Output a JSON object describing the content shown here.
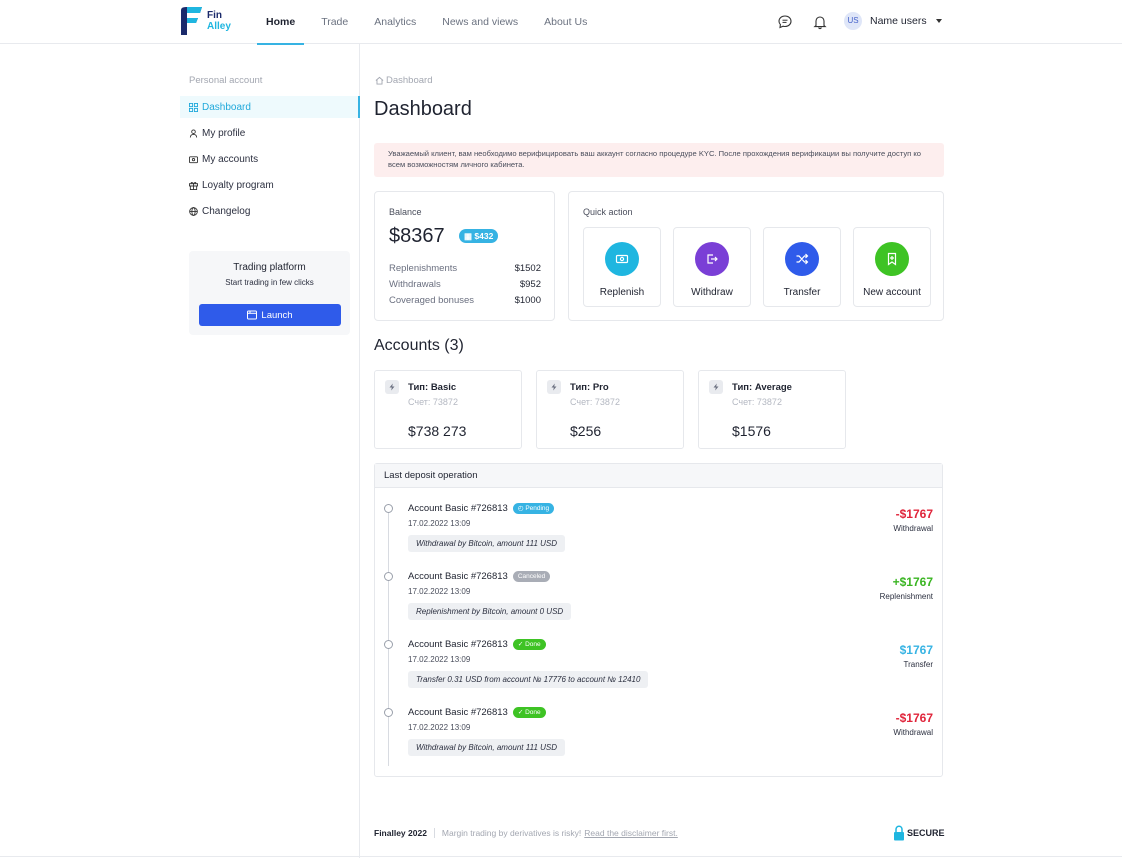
{
  "brand": {
    "line1": "Fin",
    "line2": "Alley"
  },
  "nav": {
    "items": [
      {
        "label": "Home",
        "active": true
      },
      {
        "label": "Trade"
      },
      {
        "label": "Analytics"
      },
      {
        "label": "News and views"
      },
      {
        "label": "About Us"
      }
    ]
  },
  "user": {
    "initials": "US",
    "name": "Name users"
  },
  "sidebar": {
    "title": "Personal account",
    "items": [
      {
        "label": "Dashboard",
        "icon": "grid-icon",
        "active": true
      },
      {
        "label": "My profile",
        "icon": "user-icon"
      },
      {
        "label": "My accounts",
        "icon": "wallet-icon"
      },
      {
        "label": "Loyalty program",
        "icon": "gift-icon"
      },
      {
        "label": "Changelog",
        "icon": "globe-icon"
      }
    ],
    "trading": {
      "title": "Trading platform",
      "subtitle": "Start trading in few clicks",
      "button": "Launch"
    }
  },
  "breadcrumb": "Dashboard",
  "page_title": "Dashboard",
  "alert": "Уважаемый клиент, вам необходимо верифицировать ваш аккаунт согласно процедуре KYC. После прохождения верификации вы получите доступ ко всем возможностям личного кабинета.",
  "balance": {
    "label": "Balance",
    "amount": "$8367",
    "badge": "$432",
    "rows": [
      {
        "label": "Replenishments",
        "value": "$1502"
      },
      {
        "label": "Withdrawals",
        "value": "$952"
      },
      {
        "label": "Coveraged bonuses",
        "value": "$1000"
      }
    ]
  },
  "quick_action": {
    "label": "Quick action",
    "items": [
      {
        "label": "Replenish",
        "color": "#1fb6e0",
        "icon": "cash-icon"
      },
      {
        "label": "Withdraw",
        "color": "#7a3fd6",
        "icon": "exit-icon"
      },
      {
        "label": "Transfer",
        "color": "#2f5bea",
        "icon": "shuffle-icon"
      },
      {
        "label": "New account",
        "color": "#3ec324",
        "icon": "bookmark-plus-icon"
      }
    ]
  },
  "accounts": {
    "title": "Accounts (3)",
    "items": [
      {
        "type": "Тип: Basic",
        "number": "Счет: 73872",
        "balance": "$738 273"
      },
      {
        "type": "Тип: Pro",
        "number": "Счет: 73872",
        "balance": "$256"
      },
      {
        "type": "Тип:  Average",
        "number": "Счет: 73872",
        "balance": "$1576"
      }
    ]
  },
  "operations": {
    "title": "Last deposit operation",
    "items": [
      {
        "title": "Account Basic #726813",
        "status": "Pending",
        "status_color": "#36b3e3",
        "date": "17.02.2022 13:09",
        "note": "Withdrawal by Bitcoin, amount 111 USD",
        "amount": "-$1767",
        "amount_color": "#e0243a",
        "type": "Withdrawal"
      },
      {
        "title": "Account Basic #726813",
        "status": "Canceled",
        "status_color": "#a9adb6",
        "date": "17.02.2022 13:09",
        "note": "Replenishment by Bitcoin, amount 0 USD",
        "amount": "+$1767",
        "amount_color": "#3ab522",
        "type": "Replenishment"
      },
      {
        "title": "Account Basic #726813",
        "status": "Done",
        "status_color": "#3ec324",
        "date": "17.02.2022 13:09",
        "note": "Transfer 0.31 USD from account № 17776 to account № 12410",
        "amount": "$1767",
        "amount_color": "#36b3e3",
        "type": "Transfer"
      },
      {
        "title": "Account Basic #726813",
        "status": "Done",
        "status_color": "#3ec324",
        "date": "17.02.2022 13:09",
        "note": "Withdrawal by Bitcoin, amount 111 USD",
        "amount": "-$1767",
        "amount_color": "#e0243a",
        "type": "Withdrawal"
      }
    ]
  },
  "footer": {
    "brand": "Finalley 2022",
    "warning": "Margin trading by derivatives is risky!",
    "link": "Read the disclaimer first.",
    "secure": "SECURE"
  }
}
